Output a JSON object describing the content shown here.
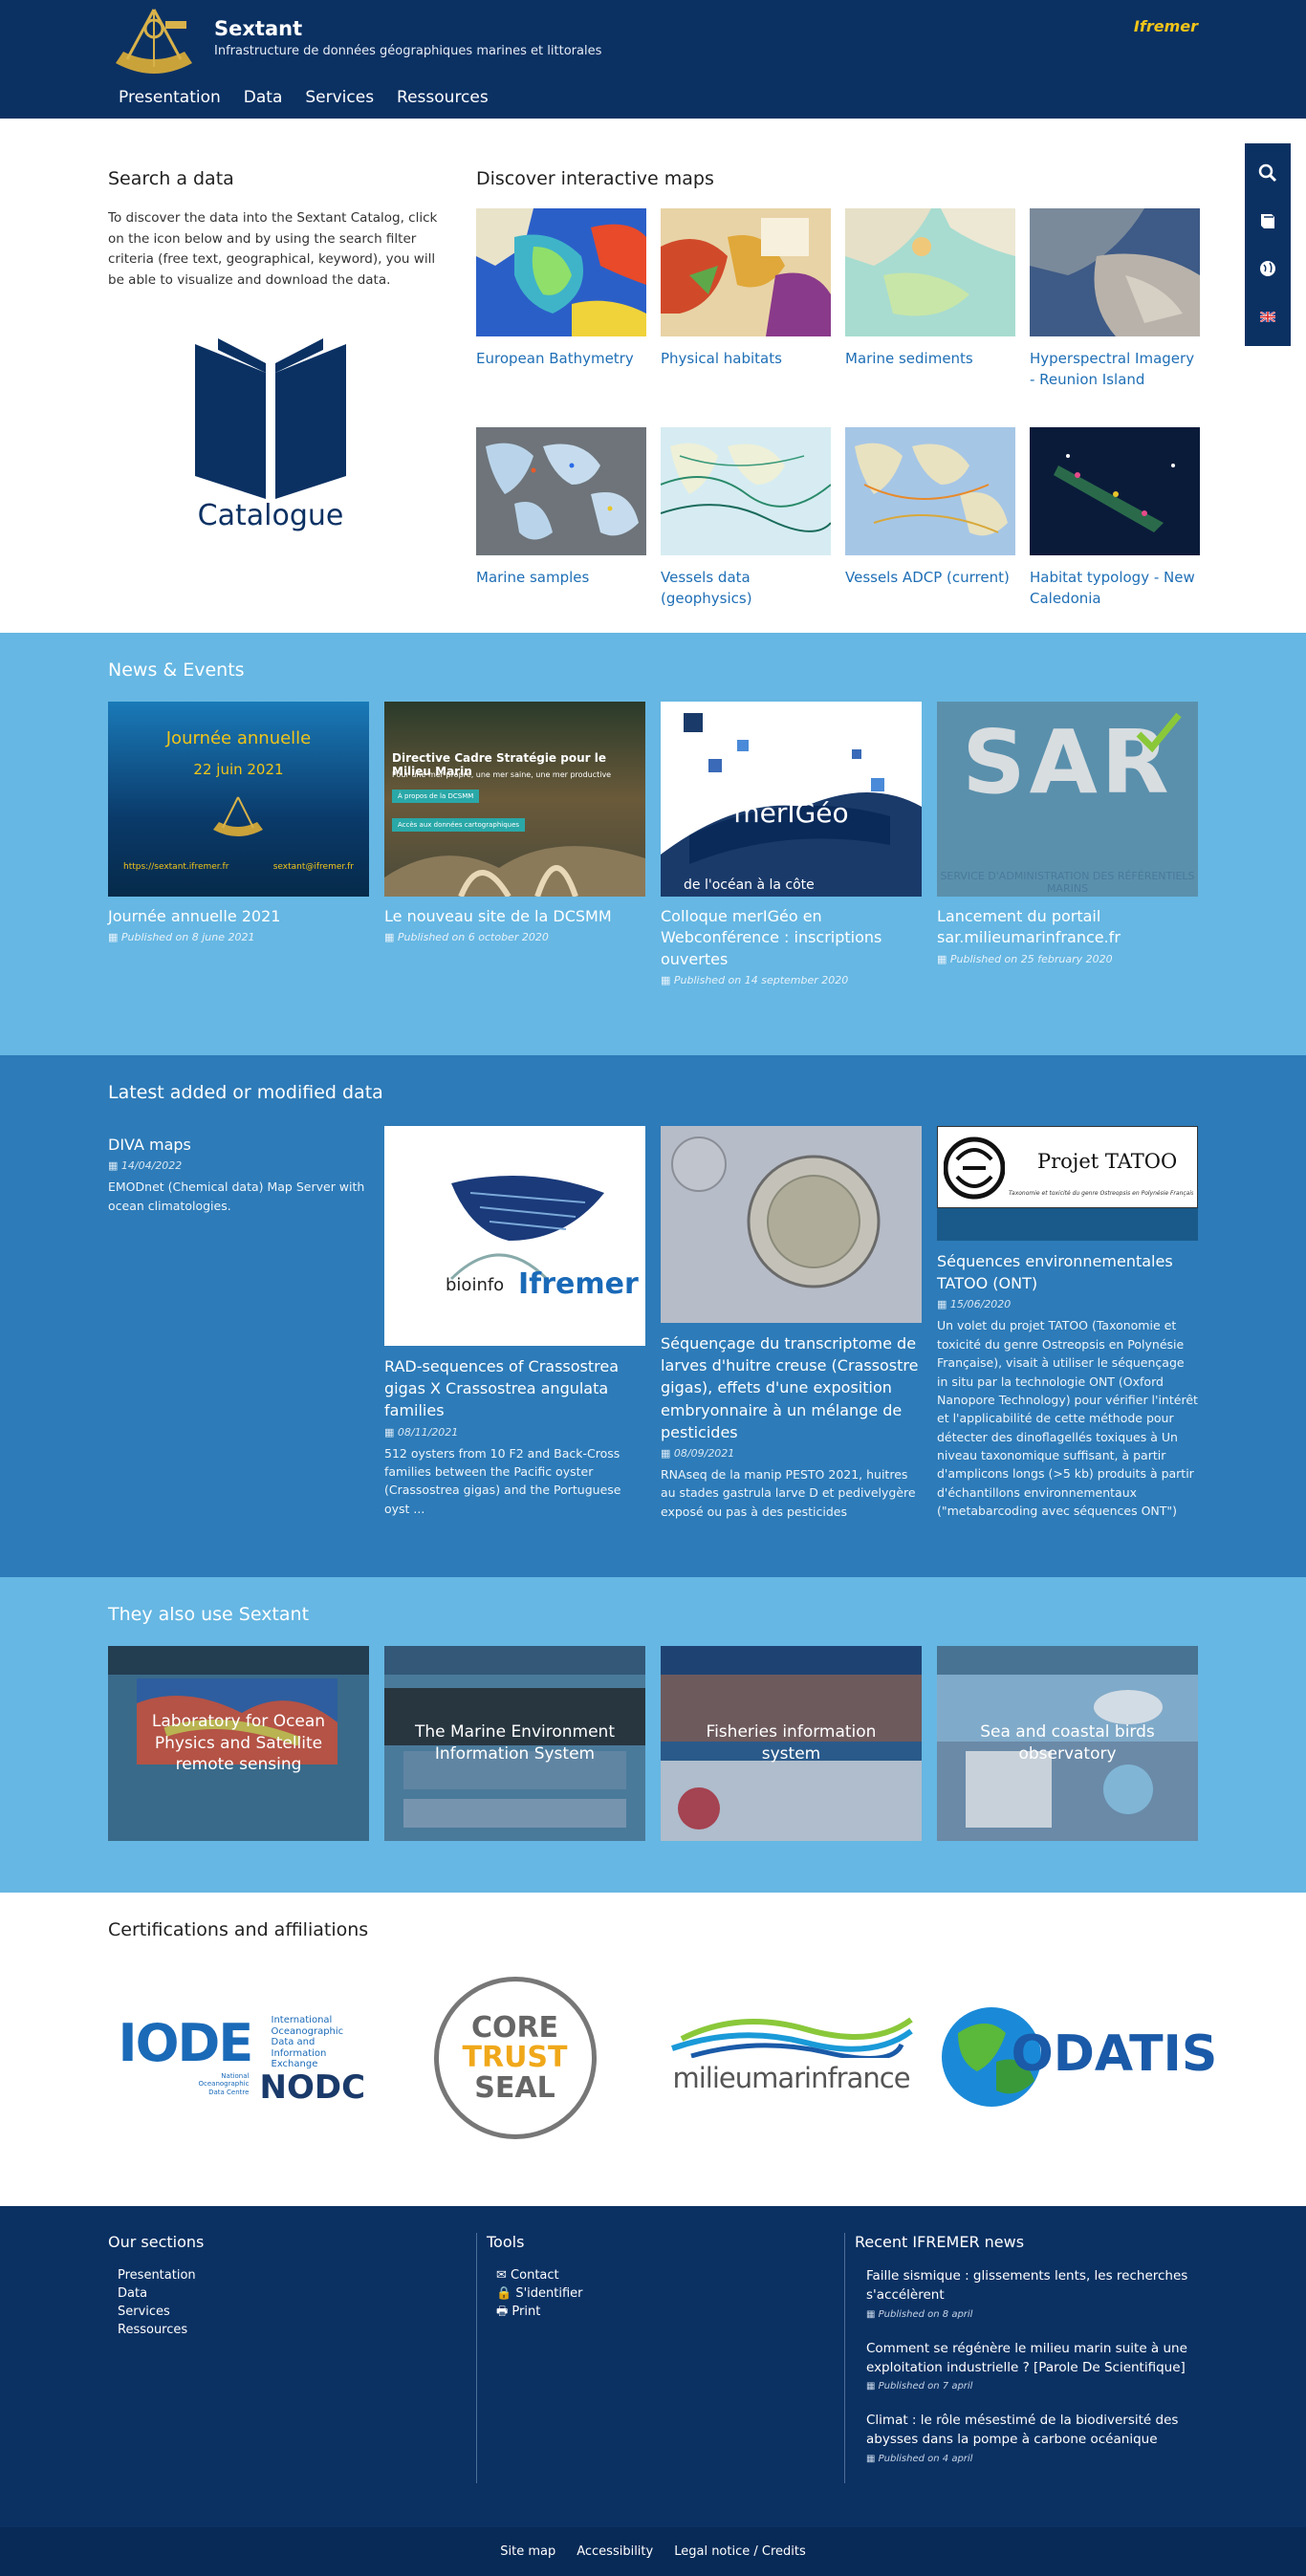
{
  "header": {
    "title": "Sextant",
    "subtitle": "Infrastructure de données géographiques marines et littorales",
    "partner_logo": "Ifremer",
    "nav": [
      "Presentation",
      "Data",
      "Services",
      "Ressources"
    ]
  },
  "side_tools": {
    "icons": [
      "search-icon",
      "book-icon",
      "globe-icon",
      "uk-flag-icon"
    ]
  },
  "search": {
    "heading": "Search a data",
    "text": "To discover the data into the Sextant Catalog, click on the icon below and by using the search filter criteria (free text, geographical, keyword), you will be able to visualize and download the data.",
    "catalogue_label": "Catalogue"
  },
  "maps": {
    "heading": "Discover interactive maps",
    "items": [
      {
        "label": "European Bathymetry",
        "color": "#3a7bd5"
      },
      {
        "label": "Physical habitats",
        "color": "#d98a3a"
      },
      {
        "label": "Marine sediments",
        "color": "#9fd4c8"
      },
      {
        "label": "Hyperspectral Imagery - Reunion Island",
        "color": "#5b6d8a"
      },
      {
        "label": "Marine samples",
        "color": "#8a8f94"
      },
      {
        "label": "Vessels data (geophysics)",
        "color": "#bfe0e8"
      },
      {
        "label": "Vessels ADCP (current)",
        "color": "#a8c8e8"
      },
      {
        "label": "Habitat typology - New Caledonia",
        "color": "#0a1a3a"
      }
    ]
  },
  "news": {
    "heading": "News & Events",
    "items": [
      {
        "title": "Journée annuelle 2021",
        "date": "Published on 8 june 2021",
        "thumb_text": [
          "Journée annuelle",
          "22 juin 2021"
        ],
        "thumb_url": "https://sextant.ifremer.fr",
        "thumb_mail": "sextant@ifremer.fr"
      },
      {
        "title": "Le nouveau site de la DCSMM",
        "date": "Published on 6 october 2020",
        "thumb_text": [
          "Directive Cadre Stratégie pour le Milieu Marin",
          "Pour une mer propre, une mer saine, une mer productive"
        ],
        "thumb_btn1": "À propos de la DCSMM",
        "thumb_btn2": "Accès aux données cartographiques"
      },
      {
        "title": "Colloque merIGéo en Webconférence : inscriptions ouvertes",
        "date": "Published on 14 september 2020",
        "thumb_text": [
          "merIGéo",
          "de l'océan à la côte"
        ]
      },
      {
        "title": "Lancement du portail sar.milieumarinfrance.fr",
        "date": "Published on 25 february 2020",
        "thumb_text": [
          "SAR",
          "SERVICE D'ADMINISTRATION DES RÉFÉRENTIELS MARINS"
        ]
      }
    ]
  },
  "latest": {
    "heading": "Latest added or modified data",
    "items": [
      {
        "title": "DIVA maps",
        "date": "14/04/2022",
        "desc": "EMODnet (Chemical data) Map Server with ocean climatologies."
      },
      {
        "title": "RAD-sequences of Crassostrea gigas X Crassostrea angulata families",
        "date": "08/11/2021",
        "desc": "512 oysters from 10 F2 and Back-Cross families between the Pacific oyster (Crassostrea gigas) and the Portuguese oyst ...",
        "thumb_text": [
          "bioinfo",
          "Ifremer"
        ]
      },
      {
        "title": "Séquençage du transcriptome de larves d'huitre creuse (Crassostre gigas), effets d'une exposition embryonnaire à un mélange de pesticides",
        "date": "08/09/2021",
        "desc": "RNAseq de la manip PESTO 2021, huitres au stades gastrula larve D et pedivelygère exposé ou pas à des pesticides"
      },
      {
        "title": "Séquences environnementales TATOO (ONT)",
        "date": "15/06/2020",
        "desc": "Un volet du projet TATOO (Taxonomie et toxicité du genre Ostreopsis en Polynésie Française), visait à utiliser le séquençage in situ par la technologie ONT (Oxford Nanopore Technology) pour vérifier l'intérêt et l'applicabilité de cette méthode pour détecter des dinoflagellés toxiques à Un niveau taxonomique suffisant, à partir d'amplicons longs (>5 kb) produits à partir d'échantillons environnementaux (\"metabarcoding avec séquences ONT\")",
        "thumb_text": [
          "Projet TATOO",
          "Taxonomie et toxicité du genre Ostreopsis en Polynésie Française"
        ]
      }
    ]
  },
  "also": {
    "heading": "They also use Sextant",
    "items": [
      {
        "label": "Laboratory for Ocean Physics and Satellite remote sensing"
      },
      {
        "label": "The Marine Environment Information System"
      },
      {
        "label": "Fisheries information system"
      },
      {
        "label": "Sea and coastal birds observatory"
      }
    ]
  },
  "cert": {
    "heading": "Certifications and affiliations",
    "iode": {
      "big": "IODE",
      "text": [
        "International",
        "Oceanographic",
        "Data and Information",
        "Exchange"
      ],
      "nodc_small": [
        "National",
        "Oceanographic",
        "Data Centre"
      ],
      "nodc": "NODC"
    },
    "cts": [
      "CORE",
      "TRUST",
      "SEAL"
    ],
    "mmf": "milieumarinfrance",
    "odatis": "ODATIS"
  },
  "footer": {
    "sections_heading": "Our sections",
    "sections": [
      "Presentation",
      "Data",
      "Services",
      "Ressources"
    ],
    "tools_heading": "Tools",
    "tools": [
      {
        "icon": "envelope-icon",
        "glyph": "✉",
        "label": "Contact"
      },
      {
        "icon": "lock-icon",
        "glyph": "🔒",
        "label": "S'identifier"
      },
      {
        "icon": "print-icon",
        "glyph": "🖶",
        "label": "Print"
      }
    ],
    "news_heading": "Recent IFREMER news",
    "news": [
      {
        "title": "Faille sismique : glissements lents, les recherches s'accélèrent",
        "date": "Published on 8 april"
      },
      {
        "title": "Comment se régénère le milieu marin suite à une exploitation industrielle ? [Parole De Scientifique]",
        "date": "Published on 7 april"
      },
      {
        "title": "Climat : le rôle mésestimé de la biodiversité des abysses dans la pompe à carbone océanique",
        "date": "Published on 4 april"
      }
    ],
    "bottom_links": [
      "Site map",
      "Accessibility",
      "Legal notice / Credits"
    ]
  }
}
